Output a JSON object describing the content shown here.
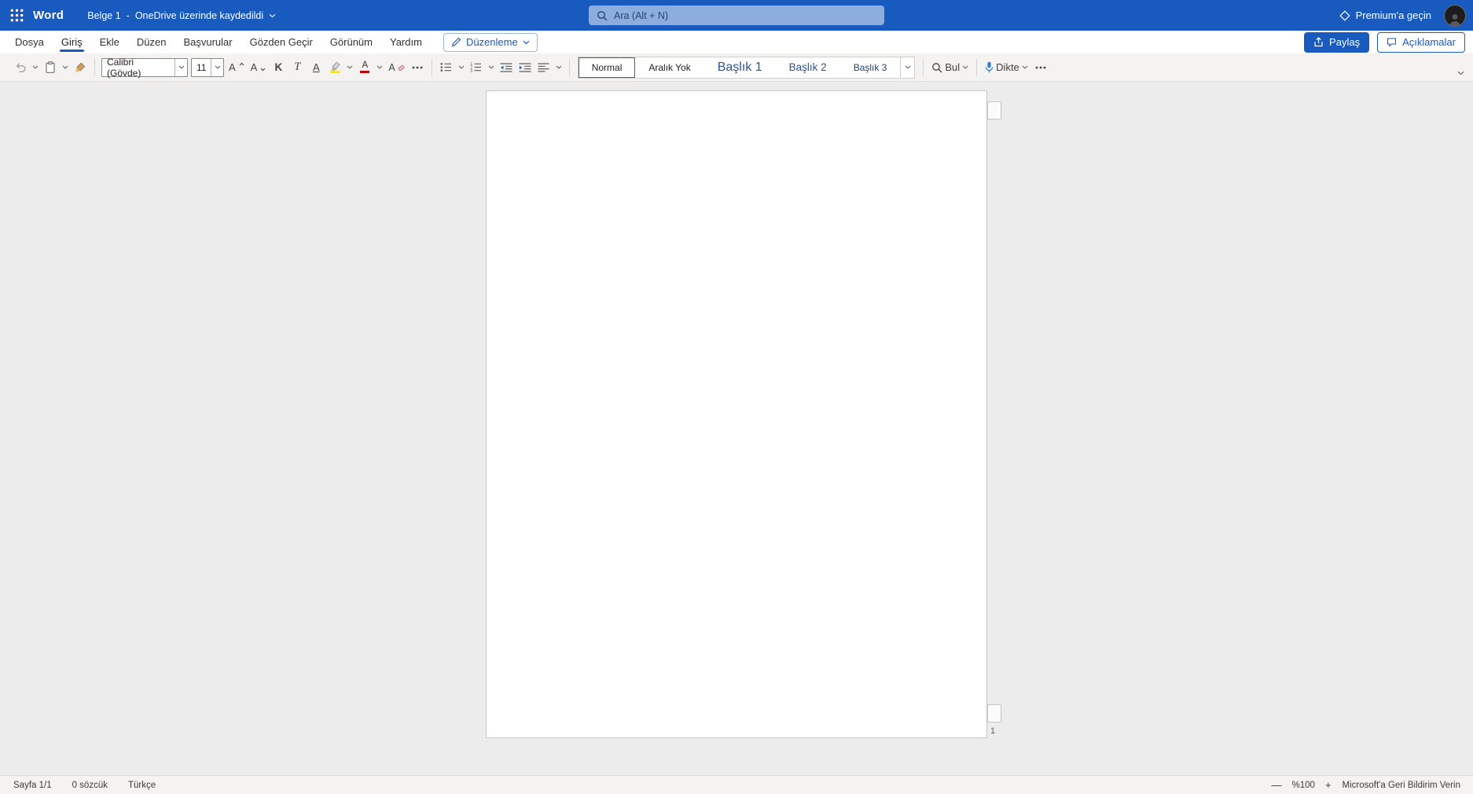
{
  "header": {
    "app_name": "Word",
    "doc_title": "Belge 1",
    "title_separator": "-",
    "save_status": "OneDrive üzerinde kaydedildi",
    "search_placeholder": "Ara (Alt + N)",
    "premium_label": "Premium'a geçin"
  },
  "tabs": {
    "items": [
      "Dosya",
      "Giriş",
      "Ekle",
      "Düzen",
      "Başvurular",
      "Gözden Geçir",
      "Görünüm",
      "Yardım"
    ],
    "active": "Giriş",
    "mode_button": "Düzenleme",
    "share_button": "Paylaş",
    "comments_button": "Açıklamalar"
  },
  "ribbon": {
    "font_name": "Calibri (Gövde)",
    "font_size": "11",
    "bold_label": "K",
    "italic_label": "T",
    "underline_label": "A",
    "grow_font_label": "A",
    "shrink_font_label": "A",
    "font_color_label": "A",
    "clear_format_label": "A",
    "styles": [
      {
        "label": "Normal",
        "selected": true
      },
      {
        "label": "Aralık Yok",
        "selected": false
      },
      {
        "label": "Başlık 1",
        "selected": false
      },
      {
        "label": "Başlık 2",
        "selected": false
      },
      {
        "label": "Başlık 3",
        "selected": false
      }
    ],
    "find_label": "Bul",
    "dictate_label": "Dikte"
  },
  "document": {
    "page_number": "1"
  },
  "status_bar": {
    "page_status": "Sayfa 1/1",
    "word_count": "0 sözcük",
    "language": "Türkçe",
    "zoom_out": "—",
    "zoom_level": "%100",
    "zoom_in": "+",
    "feedback": "Microsoft'a Geri Bildirim Verin"
  },
  "colors": {
    "header_bg": "#185abd",
    "accent": "#185abd",
    "heading_text": "#2f5496",
    "highlight_yellow": "#fce100",
    "font_color_red": "#c00000"
  },
  "icons": {
    "app-launcher": "grid-3x3-dots",
    "search": "magnifier",
    "premium": "diamond-outline",
    "account": "person-silhouette",
    "edit-mode": "pencil",
    "share": "arrow-up-from-box",
    "comments": "speech-bubble",
    "undo": "arrow-undo",
    "paste": "clipboard",
    "format-painter": "paint-brush",
    "highlight": "highlighter-yellow-bar",
    "font-color": "letter-a-red-bar",
    "clear-format": "letter-a-eraser",
    "more-options": "ellipsis-dots",
    "bullets": "bulleted-list",
    "numbering": "numbered-list",
    "outdent": "decrease-indent",
    "indent": "increase-indent",
    "align": "align-lines",
    "find": "magnifier",
    "dictate": "microphone",
    "collapse-ribbon": "chevron-down",
    "dropdown": "chevron-down"
  }
}
